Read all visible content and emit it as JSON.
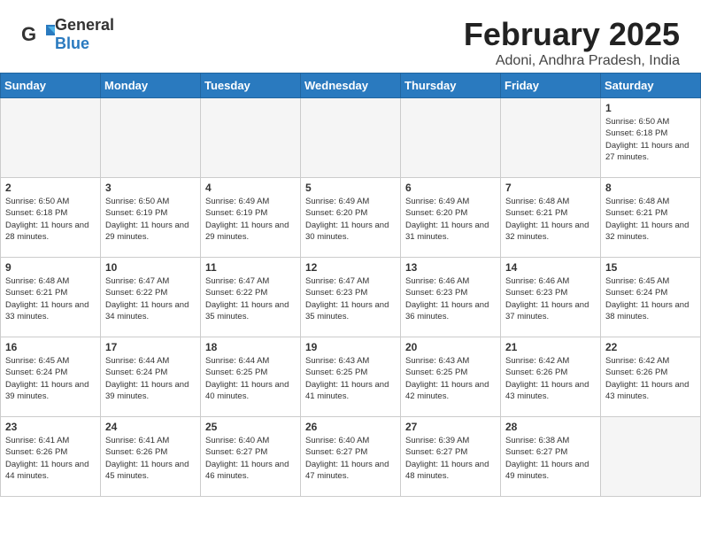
{
  "header": {
    "logo_general": "General",
    "logo_blue": "Blue",
    "title": "February 2025",
    "location": "Adoni, Andhra Pradesh, India"
  },
  "weekdays": [
    "Sunday",
    "Monday",
    "Tuesday",
    "Wednesday",
    "Thursday",
    "Friday",
    "Saturday"
  ],
  "weeks": [
    [
      {
        "day": null,
        "info": null
      },
      {
        "day": null,
        "info": null
      },
      {
        "day": null,
        "info": null
      },
      {
        "day": null,
        "info": null
      },
      {
        "day": null,
        "info": null
      },
      {
        "day": null,
        "info": null
      },
      {
        "day": "1",
        "info": "Sunrise: 6:50 AM\nSunset: 6:18 PM\nDaylight: 11 hours and 27 minutes."
      }
    ],
    [
      {
        "day": "2",
        "info": "Sunrise: 6:50 AM\nSunset: 6:18 PM\nDaylight: 11 hours and 28 minutes."
      },
      {
        "day": "3",
        "info": "Sunrise: 6:50 AM\nSunset: 6:19 PM\nDaylight: 11 hours and 29 minutes."
      },
      {
        "day": "4",
        "info": "Sunrise: 6:49 AM\nSunset: 6:19 PM\nDaylight: 11 hours and 29 minutes."
      },
      {
        "day": "5",
        "info": "Sunrise: 6:49 AM\nSunset: 6:20 PM\nDaylight: 11 hours and 30 minutes."
      },
      {
        "day": "6",
        "info": "Sunrise: 6:49 AM\nSunset: 6:20 PM\nDaylight: 11 hours and 31 minutes."
      },
      {
        "day": "7",
        "info": "Sunrise: 6:48 AM\nSunset: 6:21 PM\nDaylight: 11 hours and 32 minutes."
      },
      {
        "day": "8",
        "info": "Sunrise: 6:48 AM\nSunset: 6:21 PM\nDaylight: 11 hours and 32 minutes."
      }
    ],
    [
      {
        "day": "9",
        "info": "Sunrise: 6:48 AM\nSunset: 6:21 PM\nDaylight: 11 hours and 33 minutes."
      },
      {
        "day": "10",
        "info": "Sunrise: 6:47 AM\nSunset: 6:22 PM\nDaylight: 11 hours and 34 minutes."
      },
      {
        "day": "11",
        "info": "Sunrise: 6:47 AM\nSunset: 6:22 PM\nDaylight: 11 hours and 35 minutes."
      },
      {
        "day": "12",
        "info": "Sunrise: 6:47 AM\nSunset: 6:23 PM\nDaylight: 11 hours and 35 minutes."
      },
      {
        "day": "13",
        "info": "Sunrise: 6:46 AM\nSunset: 6:23 PM\nDaylight: 11 hours and 36 minutes."
      },
      {
        "day": "14",
        "info": "Sunrise: 6:46 AM\nSunset: 6:23 PM\nDaylight: 11 hours and 37 minutes."
      },
      {
        "day": "15",
        "info": "Sunrise: 6:45 AM\nSunset: 6:24 PM\nDaylight: 11 hours and 38 minutes."
      }
    ],
    [
      {
        "day": "16",
        "info": "Sunrise: 6:45 AM\nSunset: 6:24 PM\nDaylight: 11 hours and 39 minutes."
      },
      {
        "day": "17",
        "info": "Sunrise: 6:44 AM\nSunset: 6:24 PM\nDaylight: 11 hours and 39 minutes."
      },
      {
        "day": "18",
        "info": "Sunrise: 6:44 AM\nSunset: 6:25 PM\nDaylight: 11 hours and 40 minutes."
      },
      {
        "day": "19",
        "info": "Sunrise: 6:43 AM\nSunset: 6:25 PM\nDaylight: 11 hours and 41 minutes."
      },
      {
        "day": "20",
        "info": "Sunrise: 6:43 AM\nSunset: 6:25 PM\nDaylight: 11 hours and 42 minutes."
      },
      {
        "day": "21",
        "info": "Sunrise: 6:42 AM\nSunset: 6:26 PM\nDaylight: 11 hours and 43 minutes."
      },
      {
        "day": "22",
        "info": "Sunrise: 6:42 AM\nSunset: 6:26 PM\nDaylight: 11 hours and 43 minutes."
      }
    ],
    [
      {
        "day": "23",
        "info": "Sunrise: 6:41 AM\nSunset: 6:26 PM\nDaylight: 11 hours and 44 minutes."
      },
      {
        "day": "24",
        "info": "Sunrise: 6:41 AM\nSunset: 6:26 PM\nDaylight: 11 hours and 45 minutes."
      },
      {
        "day": "25",
        "info": "Sunrise: 6:40 AM\nSunset: 6:27 PM\nDaylight: 11 hours and 46 minutes."
      },
      {
        "day": "26",
        "info": "Sunrise: 6:40 AM\nSunset: 6:27 PM\nDaylight: 11 hours and 47 minutes."
      },
      {
        "day": "27",
        "info": "Sunrise: 6:39 AM\nSunset: 6:27 PM\nDaylight: 11 hours and 48 minutes."
      },
      {
        "day": "28",
        "info": "Sunrise: 6:38 AM\nSunset: 6:27 PM\nDaylight: 11 hours and 49 minutes."
      },
      {
        "day": null,
        "info": null
      }
    ]
  ]
}
